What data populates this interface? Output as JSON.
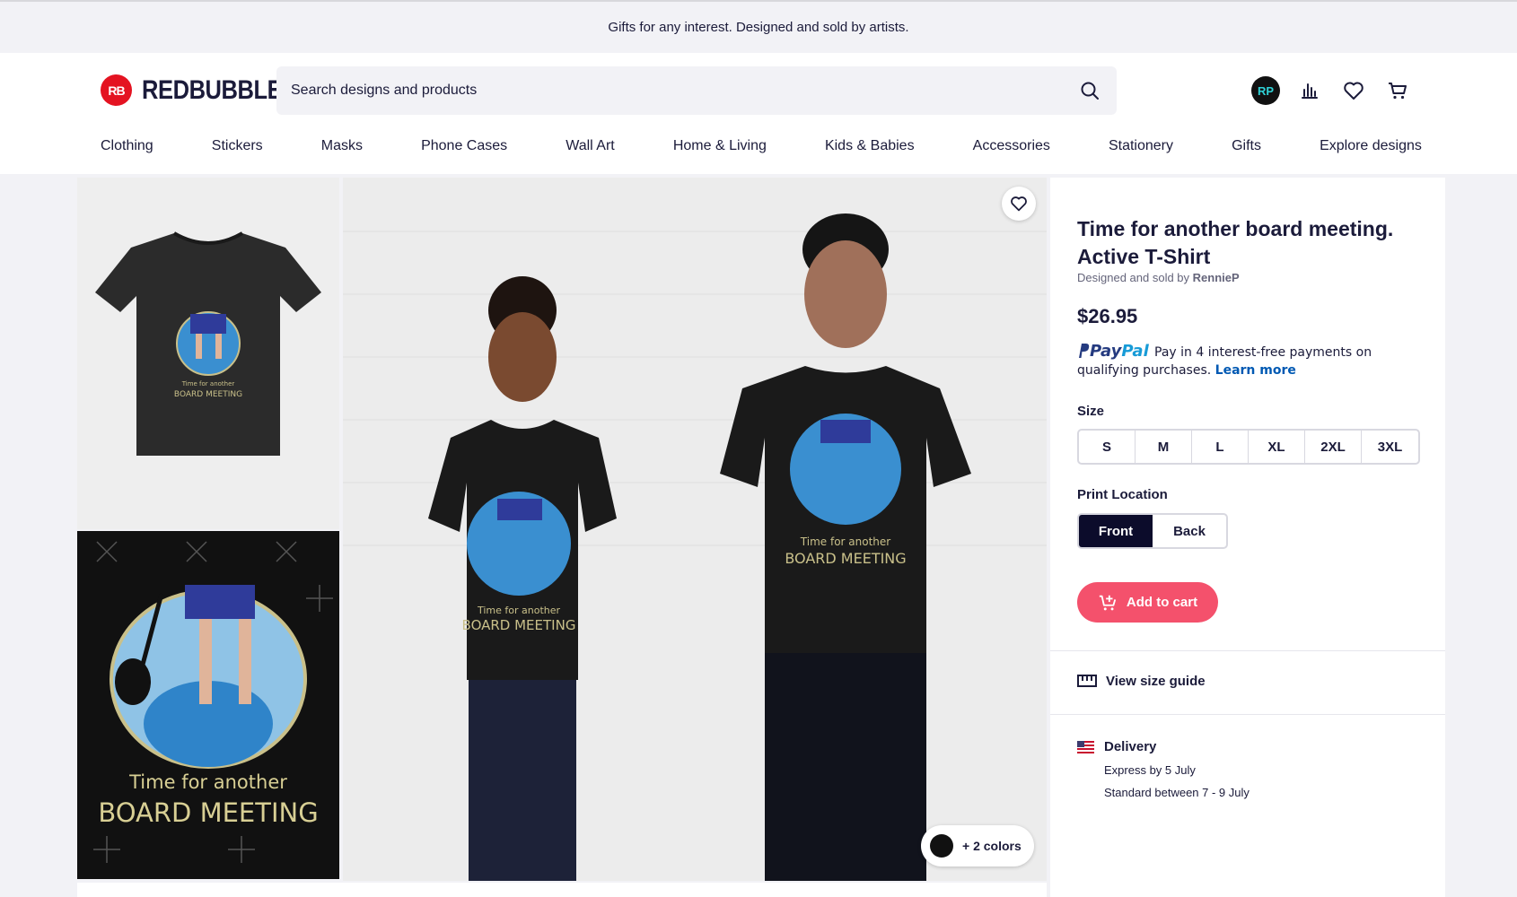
{
  "banner": {
    "text": "Gifts for any interest. Designed and sold by artists."
  },
  "logo": {
    "mark": "RB",
    "text": "REDBUBBLE"
  },
  "search": {
    "placeholder": "Search designs and products"
  },
  "header": {
    "avatar_initials": "RP"
  },
  "nav": [
    "Clothing",
    "Stickers",
    "Masks",
    "Phone Cases",
    "Wall Art",
    "Home & Living",
    "Kids & Babies",
    "Accessories",
    "Stationery",
    "Gifts",
    "Explore designs"
  ],
  "artwork": {
    "line1": "Time for another",
    "line2": "BOARD MEETING"
  },
  "gallery": {
    "colors_label": "+ 2 colors"
  },
  "product": {
    "title": "Time for another board meeting. Active T-Shirt",
    "designed_by_prefix": "Designed and sold by",
    "artist": "RennieP",
    "price": "$26.95"
  },
  "paypal": {
    "logo_pay": "Pay",
    "logo_pal": "Pal",
    "text": "Pay in 4 interest-free payments on qualifying purchases.",
    "learn_more": "Learn more"
  },
  "size": {
    "label": "Size",
    "options": [
      "S",
      "M",
      "L",
      "XL",
      "2XL",
      "3XL"
    ]
  },
  "print_location": {
    "label": "Print Location",
    "options": [
      "Front",
      "Back"
    ],
    "selected": "Front"
  },
  "add_to_cart": "Add to cart",
  "size_guide": "View size guide",
  "delivery": {
    "title": "Delivery",
    "express": "Express by 5 July",
    "standard": "Standard between 7 - 9 July"
  },
  "colors": {
    "brand_red": "#e41321",
    "cart_pink": "#f4516c",
    "navy": "#0c0c2b",
    "link_blue": "#0059b3"
  }
}
